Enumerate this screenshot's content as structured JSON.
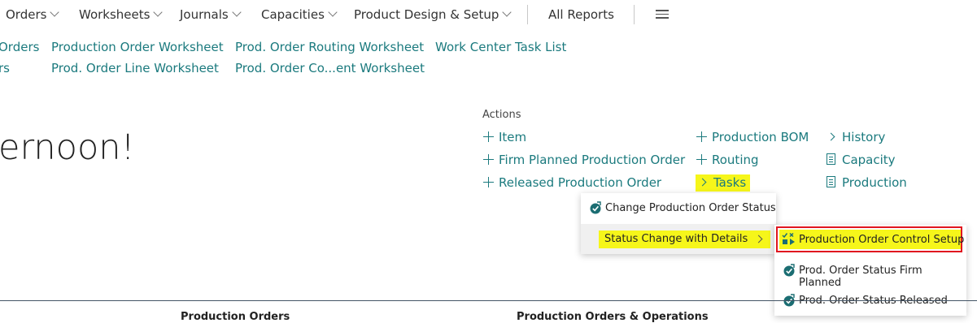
{
  "nav": {
    "items": [
      {
        "label": "Orders",
        "dropdown": true
      },
      {
        "label": "Worksheets",
        "dropdown": true
      },
      {
        "label": "Journals",
        "dropdown": true
      },
      {
        "label": "Capacities",
        "dropdown": true
      },
      {
        "label": "Product Design & Setup",
        "dropdown": true
      },
      {
        "label": "All Reports",
        "dropdown": false
      }
    ]
  },
  "links": {
    "row1": [
      "Orders",
      "Production Order Worksheet",
      "Prod. Order Routing Worksheet",
      "Work Center Task List"
    ],
    "row2": [
      "rs",
      "Prod. Order Line Worksheet",
      "Prod. Order Co...ent Worksheet"
    ]
  },
  "greeting": "ernoon!",
  "actions": {
    "label": "Actions",
    "col1": [
      "Item",
      "Firm Planned Production Order",
      "Released Production Order"
    ],
    "col2": [
      "Production BOM",
      "Routing",
      "Tasks"
    ],
    "col3": [
      "History",
      "Capacity",
      "Production"
    ]
  },
  "menu1": {
    "items": [
      "Change Production Order Status",
      "Status Change with Details"
    ]
  },
  "menu2": {
    "items": [
      "Production Order Control Setup",
      "Prod. Order Status Firm Planned",
      "Prod. Order Status Released"
    ]
  },
  "sections": [
    "Production Orders",
    "Production Orders & Operations"
  ],
  "colors": {
    "link": "#1b7a7e",
    "highlight": "#f6f61a",
    "focus_border": "#e0161f"
  }
}
